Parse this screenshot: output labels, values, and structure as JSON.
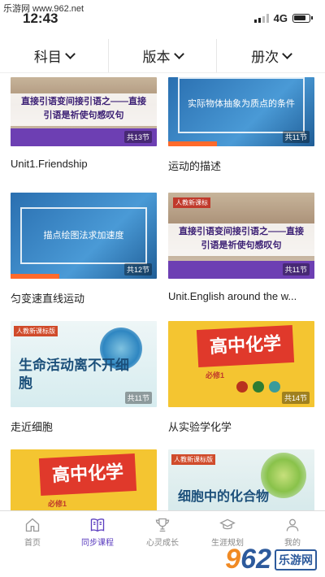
{
  "watermark_top": "乐游网 www.962.net",
  "status": {
    "time": "12:43",
    "network": "4G"
  },
  "filters": [
    {
      "label": "科目"
    },
    {
      "label": "版本"
    },
    {
      "label": "册次"
    }
  ],
  "cards": [
    {
      "title": "Unit1.Friendship",
      "count": "共13节",
      "thumb_text": "直接引语变间接引语之——直接引语是祈使句感叹句",
      "badge": ""
    },
    {
      "title": "运动的描述",
      "count": "共11节",
      "thumb_text": "实际物体抽象为质点的条件",
      "badge": ""
    },
    {
      "title": "匀变速直线运动",
      "count": "共12节",
      "thumb_text": "描点绘图法求加速度",
      "badge": ""
    },
    {
      "title": "Unit.English around the w...",
      "count": "共11节",
      "thumb_text": "直接引语变间接引语之——直接引语是祈使句感叹句",
      "badge": "人教新课标"
    },
    {
      "title": "走近细胞",
      "count": "共11节",
      "thumb_text": "生命活动离不开细胞",
      "badge": "人教新课标版"
    },
    {
      "title": "从实验学化学",
      "count": "共14节",
      "thumb_text": "高中化学",
      "sub": "必修1",
      "badge": ""
    },
    {
      "title": "",
      "count": "",
      "thumb_text": "高中化学",
      "sub": "必修1",
      "badge": ""
    },
    {
      "title": "",
      "count": "",
      "thumb_text": "细胞中的化合物",
      "badge": "人教新课标版"
    }
  ],
  "tabs": [
    {
      "label": "首页",
      "active": false
    },
    {
      "label": "同步课程",
      "active": true
    },
    {
      "label": "心灵成长",
      "active": false
    },
    {
      "label": "生涯规划",
      "active": false
    },
    {
      "label": "我的",
      "active": false
    }
  ],
  "watermark_brand": {
    "logo_a": "9",
    "logo_b": "62",
    "site": "乐游网"
  },
  "colors": {
    "accent": "#5b3dbf",
    "tab_inactive": "#888888"
  }
}
